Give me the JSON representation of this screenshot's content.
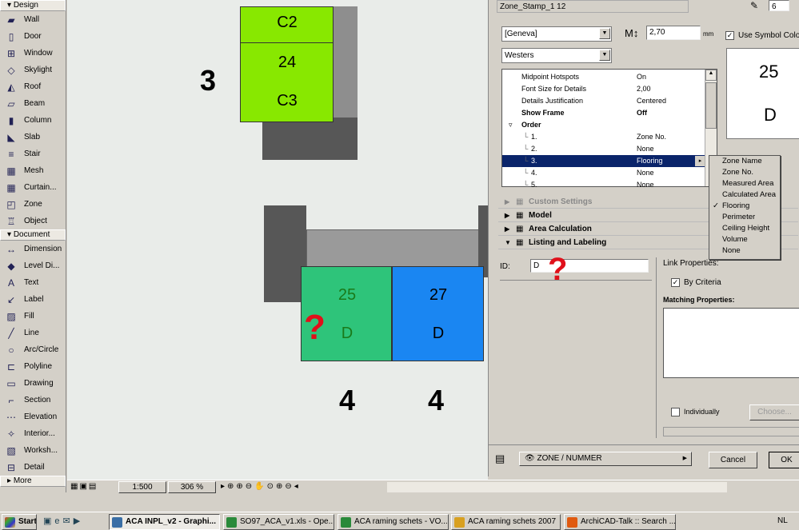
{
  "toolbox": {
    "design_header": "Design",
    "design_tools": [
      {
        "label": "Wall",
        "icon": "wall-icon"
      },
      {
        "label": "Door",
        "icon": "door-icon"
      },
      {
        "label": "Window",
        "icon": "window-icon"
      },
      {
        "label": "Skylight",
        "icon": "skylight-icon"
      },
      {
        "label": "Roof",
        "icon": "roof-icon"
      },
      {
        "label": "Beam",
        "icon": "beam-icon"
      },
      {
        "label": "Column",
        "icon": "column-icon"
      },
      {
        "label": "Slab",
        "icon": "slab-icon"
      },
      {
        "label": "Stair",
        "icon": "stair-icon"
      },
      {
        "label": "Mesh",
        "icon": "mesh-icon"
      },
      {
        "label": "Curtain...",
        "icon": "curtain-wall-icon"
      },
      {
        "label": "Zone",
        "icon": "zone-icon"
      },
      {
        "label": "Object",
        "icon": "object-icon"
      }
    ],
    "document_header": "Document",
    "document_tools": [
      {
        "label": "Dimension",
        "icon": "dimension-icon"
      },
      {
        "label": "Level Di...",
        "icon": "level-dimension-icon"
      },
      {
        "label": "Text",
        "icon": "text-icon"
      },
      {
        "label": "Label",
        "icon": "label-icon"
      },
      {
        "label": "Fill",
        "icon": "fill-icon"
      },
      {
        "label": "Line",
        "icon": "line-icon"
      },
      {
        "label": "Arc/Circle",
        "icon": "arc-circle-icon"
      },
      {
        "label": "Polyline",
        "icon": "polyline-icon"
      },
      {
        "label": "Drawing",
        "icon": "drawing-icon"
      },
      {
        "label": "Section",
        "icon": "section-icon"
      },
      {
        "label": "Elevation",
        "icon": "elevation-icon"
      },
      {
        "label": "Interior...",
        "icon": "interior-icon"
      },
      {
        "label": "Worksh...",
        "icon": "worksheet-icon"
      },
      {
        "label": "Detail",
        "icon": "detail-icon"
      }
    ],
    "more": "More"
  },
  "canvas": {
    "zones": [
      {
        "top": "C2",
        "num": "24",
        "bottom": "C3"
      },
      {
        "num": "25",
        "id": "D"
      },
      {
        "num": "27",
        "id": "D"
      }
    ],
    "story_labels": [
      "3",
      "4",
      "4"
    ],
    "toolbar_sub": "2",
    "colors": {
      "green": "#88e800",
      "teal": "#2ec47a",
      "blue": "#1a86f2"
    }
  },
  "dialog": {
    "stamp_name": "Zone_Stamp_1 12",
    "pen_value": "6",
    "font": "[Geneva]",
    "script": "Westers",
    "text_size": "2,70",
    "unit": "mm",
    "use_symbol_colors": "Use Symbol Colors",
    "preview": {
      "num": "25",
      "id": "D"
    },
    "properties": [
      {
        "k": "Midpoint Hotspots",
        "v": "On"
      },
      {
        "k": "Font Size for Details",
        "v": "2,00"
      },
      {
        "k": "Details Justification",
        "v": "Centered"
      },
      {
        "k": "Show Frame",
        "v": "Off"
      },
      {
        "k": "Order",
        "v": ""
      },
      {
        "k": "1.",
        "v": "Zone No."
      },
      {
        "k": "2.",
        "v": "None"
      },
      {
        "k": "3.",
        "v": "Flooring"
      },
      {
        "k": "4.",
        "v": "None"
      },
      {
        "k": "5.",
        "v": "None"
      }
    ],
    "popup_options": [
      "Zone Name",
      "Zone No.",
      "Measured Area",
      "Calculated Area",
      "Flooring",
      "Perimeter",
      "Ceiling Height",
      "Volume",
      "None"
    ],
    "popup_selected": "Flooring",
    "sections": [
      "Custom Settings",
      "Model",
      "Area Calculation",
      "Listing and Labeling"
    ],
    "id_label": "ID:",
    "id_value": "D",
    "link_properties": "Link Properties:",
    "by_criteria": "By Criteria",
    "matching_properties": "Matching Properties:",
    "individually": "Individually",
    "choose": "Choose...",
    "layer": "ZONE / NUMMER",
    "cancel": "Cancel",
    "ok": "OK"
  },
  "statusbar": {
    "scale": "1:500",
    "zoom": "306 %"
  },
  "taskbar": {
    "start": "Start",
    "tasks": [
      "ACA INPL_v2 - Graphi...",
      "SO97_ACA_v1.xls - Ope...",
      "ACA raming schets - VO....",
      "ACA raming schets 2007",
      "ArchiCAD-Talk :: Search ..."
    ],
    "lang": "NL"
  }
}
